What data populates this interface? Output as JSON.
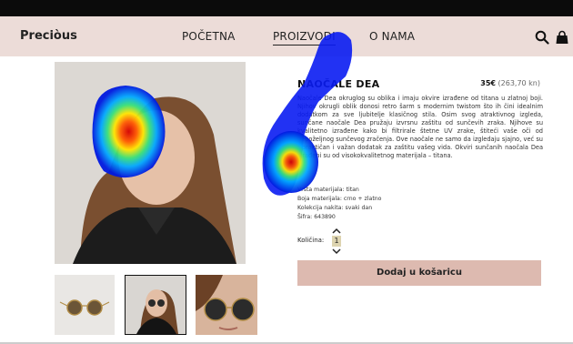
{
  "nav": {
    "logo": "Preciòus",
    "links": [
      "POČETNA",
      "PROIZVODI",
      "O NAMA"
    ],
    "active_index": 1,
    "icons": [
      "search-icon",
      "shopping-bag-icon"
    ]
  },
  "product": {
    "title": "NAOČALE DEA",
    "price_eur": "35€",
    "price_hrk": "(263,70 kn)",
    "description": "Naočale Dea okruglog su oblika i imaju okvire izrađene od titana u zlatnoj boji. Njihov okrugli oblik donosi retro šarm s modernim twistom što ih čini idealnim dodatkom za sve ljubitelje klasičnog stila. Osim svog atraktivnog izgleda, sunčane naočale Dea pružaju izvrsnu zaštitu od sunčevih zraka. Njihove su kvalitetno izrađene kako bi filtrirale štetne UV zrake, štiteći vaše oči od nepoželjnog sunčevog zračenja. Ove naočale ne samo da izgledaju sjajno, već su i praktičan i važan dodatak za zaštitu vašeg vida. Okviri sunčanih naočala Dea izrađeni su od visokokvalitetnog materijala – titana.",
    "specs": [
      "Vrsta materijala: titan",
      "Boja materijala: crno + zlatno",
      "Kolekcija nakita: svaki dan",
      "Šifra: 643890"
    ],
    "quantity_label": "Količina:",
    "quantity_value": "1",
    "add_to_cart_label": "Dodaj u košaricu"
  },
  "colors": {
    "nav_bg": "#ecdcd8",
    "button_bg": "#ddbab0",
    "qty_bg": "#ddd4b0"
  }
}
